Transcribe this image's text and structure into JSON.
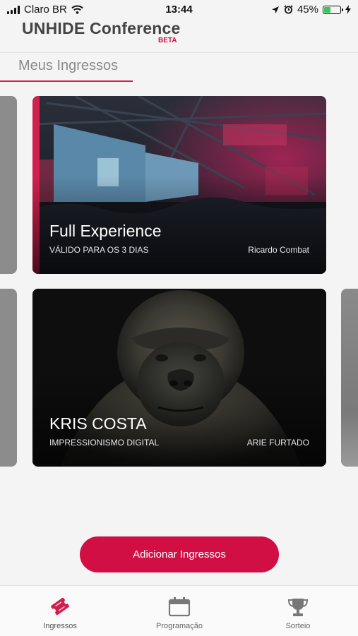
{
  "status_bar": {
    "carrier": "Claro BR",
    "time": "13:44",
    "battery": "45%",
    "battery_level": 0.45
  },
  "header": {
    "title": "UNHIDE Conference",
    "badge": "BETA"
  },
  "section_tab": {
    "label": "Meus Ingressos"
  },
  "tickets": [
    {
      "title": "Full Experience",
      "subtitle": "VÁLIDO PARA OS 3 DIAS",
      "owner": "Ricardo Combat"
    },
    {
      "title": "KRIS COSTA",
      "subtitle": "IMPRESSIONISMO DIGITAL",
      "owner": "ARIE FURTADO"
    }
  ],
  "add_button": {
    "label": "Adicionar Ingressos"
  },
  "bottom_nav": [
    {
      "label": "Ingressos",
      "icon": "ticket-icon",
      "active": true
    },
    {
      "label": "Programação",
      "icon": "calendar-icon",
      "active": false
    },
    {
      "label": "Sorteio",
      "icon": "trophy-icon",
      "active": false
    }
  ],
  "colors": {
    "accent": "#d2204e",
    "battery_fill": "#35c759"
  }
}
